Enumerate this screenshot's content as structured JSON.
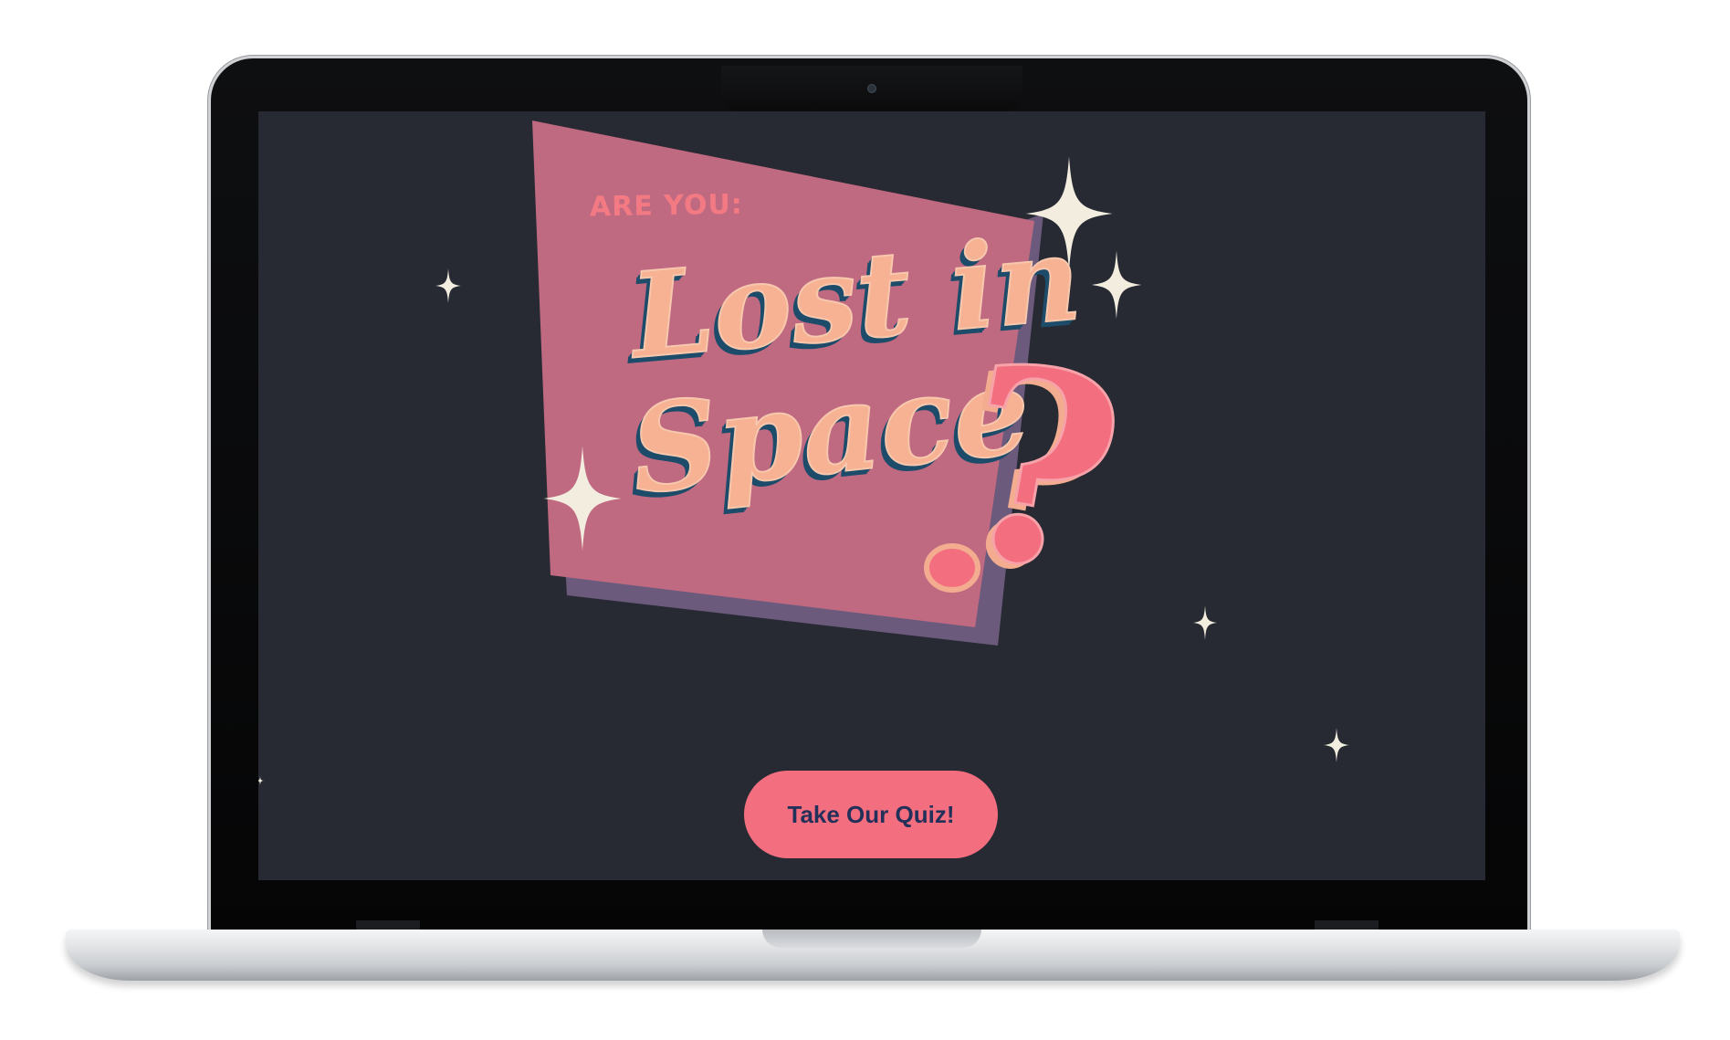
{
  "hero": {
    "kicker": "ARE YOU:",
    "title_line_1": "Lost in",
    "title_line_2": "Space",
    "title_mark": "?"
  },
  "cta": {
    "label": "Take Our Quiz!"
  },
  "colors": {
    "screen_background": "#272a33",
    "card_front": "#c06a82",
    "card_back": "#6c5a7d",
    "title_fill": "#f6b292",
    "title_outline": "#1d4c6a",
    "accent_pink": "#f36e7f",
    "sparkle": "#f3ede0",
    "button_text": "#23305a"
  },
  "icons": {
    "sparkle": "four-point-star-icon"
  }
}
